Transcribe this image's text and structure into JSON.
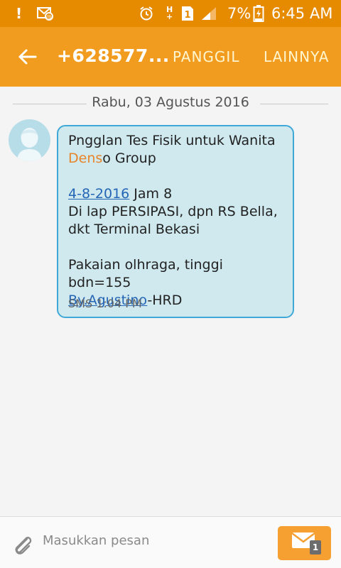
{
  "status_bar": {
    "exclamation": "!",
    "network_type": "H",
    "network_sub": "+",
    "sim_slot": "1",
    "battery_percent": "7%",
    "time": "6:45 AM"
  },
  "app_bar": {
    "contact": "+628577...",
    "call_label": "PANGGIL",
    "more_label": "LAINNYA"
  },
  "conversation": {
    "date": "Rabu, 03 Agustus 2016"
  },
  "message": {
    "line1": "Pngglan Tes Fisik untuk Wanita",
    "line2_highlight": "Dens",
    "line2_rest": "o Group",
    "date_link": "4-8-2016",
    "line4_rest": " Jam 8",
    "line5": "Di lap PERSIPASI, dpn RS Bella,",
    "line6": "dkt Terminal Bekasi",
    "line8": "Pakaian olhraga, tinggi bdn=155",
    "sender_link": "By.Agustino",
    "sender_rest": "-HRD",
    "meta": "SMS 1:04 PM"
  },
  "composer": {
    "placeholder": "Masukkan pesan",
    "sim_badge": "1"
  }
}
